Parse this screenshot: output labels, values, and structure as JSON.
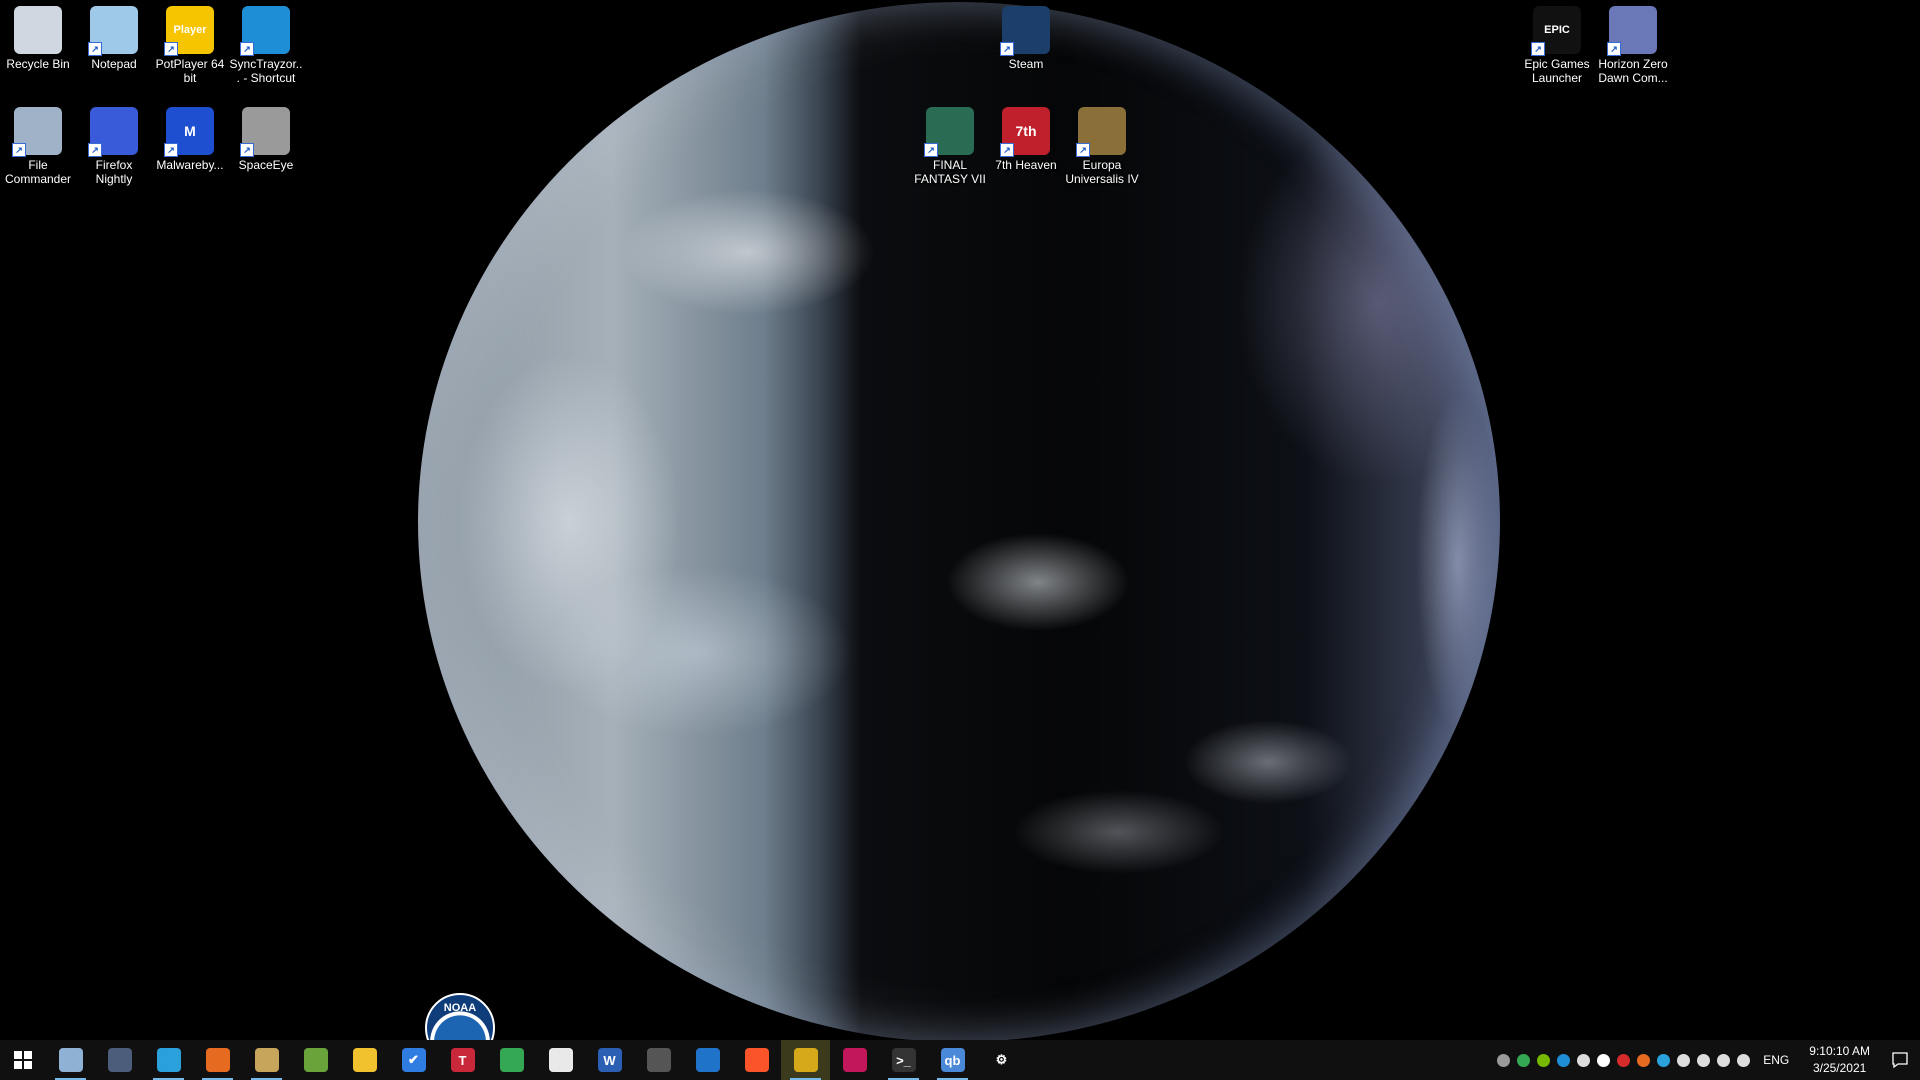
{
  "desktop": {
    "wallpaper": "Earth satellite view",
    "icons_left": [
      {
        "label": "Recycle Bin",
        "icon": "recycle-bin-icon",
        "color": "#cfd8e0",
        "shortcut": false
      },
      {
        "label": "Notepad",
        "icon": "notepad-icon",
        "color": "#9ec9e8",
        "shortcut": true
      },
      {
        "label": "PotPlayer 64 bit",
        "icon": "potplayer-icon",
        "color": "#f7c400",
        "glyph": "Player",
        "shortcut": true
      },
      {
        "label": "SyncTrayzor... - Shortcut",
        "icon": "synctrayzor-icon",
        "color": "#1e8fd6",
        "shortcut": true
      },
      {
        "label": "File Commander",
        "icon": "file-commander-icon",
        "color": "#9fb2c8",
        "shortcut": true
      },
      {
        "label": "Firefox Nightly",
        "icon": "firefox-nightly-icon",
        "color": "#3a5bd9",
        "shortcut": true
      },
      {
        "label": "Malwareby...",
        "icon": "malwarebytes-icon",
        "color": "#1f4fd1",
        "glyph": "M",
        "shortcut": true
      },
      {
        "label": "SpaceEye",
        "icon": "spaceeye-icon",
        "color": "#9a9a9a",
        "shortcut": true
      }
    ],
    "icons_center": [
      {
        "label": "Steam",
        "icon": "steam-icon",
        "color": "#1b3f6a",
        "shortcut": true
      },
      {
        "label": "FINAL FANTASY VII",
        "icon": "final-fantasy-vii-icon",
        "color": "#2a6b54",
        "shortcut": true
      },
      {
        "label": "7th Heaven",
        "icon": "7th-heaven-icon",
        "color": "#c0202b",
        "glyph": "7th",
        "shortcut": true
      },
      {
        "label": "Europa Universalis IV",
        "icon": "europa-universalis-icon",
        "color": "#8a7038",
        "shortcut": true
      }
    ],
    "icons_right": [
      {
        "label": "Epic Games Launcher",
        "icon": "epic-games-icon",
        "color": "#111111",
        "glyph": "EPIC",
        "shortcut": true
      },
      {
        "label": "Horizon Zero Dawn Com...",
        "icon": "horizon-zero-dawn-icon",
        "color": "#6a78b8",
        "shortcut": true
      }
    ],
    "noaa_logo_text": "NOAA"
  },
  "taskbar": {
    "start_icon": "windows-start-icon",
    "apps": [
      {
        "name": "file-commander-icon",
        "color": "#8fb1d3",
        "glyph": "",
        "running": true
      },
      {
        "name": "keepass-icon",
        "color": "#4b5d7a",
        "glyph": "",
        "running": false
      },
      {
        "name": "telegram-icon",
        "color": "#2aa1da",
        "glyph": "",
        "running": true
      },
      {
        "name": "firefox-icon",
        "color": "#e66a1f",
        "glyph": "",
        "running": true
      },
      {
        "name": "notepad-app-icon",
        "color": "#c7a55a",
        "glyph": "",
        "running": true
      },
      {
        "name": "feed-reader-icon",
        "color": "#6ba33b",
        "glyph": "",
        "running": false
      },
      {
        "name": "file-explorer-icon",
        "color": "#f2c12e",
        "glyph": "",
        "running": false
      },
      {
        "name": "microsoft-todo-icon",
        "color": "#2f7de0",
        "glyph": "✔",
        "running": false
      },
      {
        "name": "todoist-icon",
        "color": "#c9283a",
        "glyph": "T",
        "running": false
      },
      {
        "name": "chrome-icon",
        "color": "#34a853",
        "glyph": "",
        "running": false
      },
      {
        "name": "librewolf-icon",
        "color": "#e9e9e9",
        "glyph": "",
        "running": false
      },
      {
        "name": "word-icon",
        "color": "#2b5fb4",
        "glyph": "W",
        "running": false
      },
      {
        "name": "video-editor-icon",
        "color": "#555555",
        "glyph": "",
        "running": false
      },
      {
        "name": "thunderbird-icon",
        "color": "#1f73c9",
        "glyph": "",
        "running": false
      },
      {
        "name": "brave-icon",
        "color": "#fb542b",
        "glyph": "",
        "running": false
      },
      {
        "name": "image-viewer-icon",
        "color": "#d6a91a",
        "glyph": "",
        "running": true,
        "active": true
      },
      {
        "name": "snipping-tool-icon",
        "color": "#c2185b",
        "glyph": "",
        "running": false
      },
      {
        "name": "terminal-icon",
        "color": "#333333",
        "glyph": ">_",
        "running": true
      },
      {
        "name": "qbittorrent-icon",
        "color": "#4a88d8",
        "glyph": "qb",
        "running": true
      },
      {
        "name": "settings-icon",
        "color": "#101010",
        "glyph": "⚙",
        "running": false
      }
    ],
    "tray_icons": [
      {
        "name": "spaceeye-tray-icon",
        "color": "#9a9a9a"
      },
      {
        "name": "chrome-tray-icon",
        "color": "#34a853"
      },
      {
        "name": "nvidia-tray-icon",
        "color": "#76b900"
      },
      {
        "name": "syncthing-tray-icon",
        "color": "#1e8fd6"
      },
      {
        "name": "shield-tray-icon",
        "color": "#dddddd"
      },
      {
        "name": "dropbox-tray-icon",
        "color": "#ffffff"
      },
      {
        "name": "malwarebytes-tray-icon",
        "color": "#d62b2b"
      },
      {
        "name": "firefox-tray-icon",
        "color": "#e66a1f"
      },
      {
        "name": "telegram-tray-icon",
        "color": "#2aa1da"
      },
      {
        "name": "usb-tray-icon",
        "color": "#dddddd"
      },
      {
        "name": "battery-tray-icon",
        "color": "#dddddd"
      },
      {
        "name": "wifi-tray-icon",
        "color": "#dddddd"
      },
      {
        "name": "volume-tray-icon",
        "color": "#dddddd"
      }
    ],
    "language": "ENG",
    "time": "9:10:10 AM",
    "date": "3/25/2021",
    "notification_icon": "action-center-icon"
  }
}
